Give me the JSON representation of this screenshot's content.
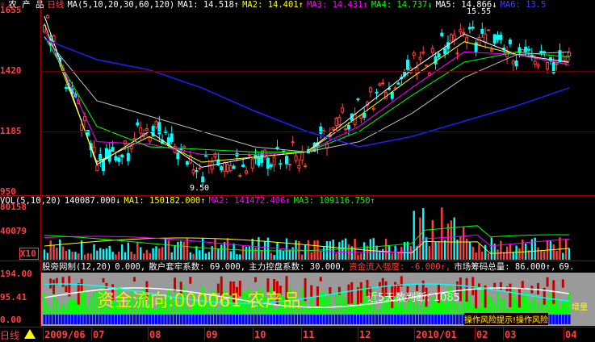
{
  "main": {
    "title_prefix": "农 产 品",
    "period": "日线",
    "ma_params": "MA(5,10,20,30,60,120)",
    "ma1": "MA1: 14.518↑",
    "ma2": "MA2: 14.401↑",
    "ma3": "MA3: 14.431↑",
    "ma4": "MA4: 14.737↓",
    "ma5": "MA5: 14.866↓",
    "ma6": "MA6: 13.5",
    "high_label": "15.55",
    "low_label": "9.50",
    "y_labels": [
      "1655",
      "1420",
      "1185",
      "950"
    ]
  },
  "volume": {
    "params": "VOL(5,10,20)",
    "value": "140087.000↓",
    "ma1": "MA1: 150182.000↑",
    "ma2": "MA2: 141472.406↑",
    "ma3": "MA3: 109116.750↑",
    "y_labels": [
      "80158",
      "40079",
      "X10"
    ]
  },
  "indicator": {
    "name": "股旁网制(12,20)",
    "value": "0.000,",
    "text1": "散户套牢系数: 69.000,",
    "text2": "主力控盘系数: 30.000,",
    "text3": "资金流入强度: -6.000↑,",
    "text4": "市场筹码总量: 86.000↑,",
    "text5": "69.",
    "y_labels": [
      "194.00",
      "95.41",
      "0.00"
    ],
    "watermark": "资金流向:000061 农产品",
    "watermark2": "近5天数判断: 1085",
    "right_note": "增量",
    "bottom_note": "操作风险提示!操作风险"
  },
  "datebar": {
    "period": "日线",
    "dates": [
      "2009/06",
      "07",
      "08",
      "09",
      "10",
      "11",
      "12",
      "2010/01",
      "02",
      "03",
      "04"
    ]
  },
  "chart_data": {
    "type": "line",
    "title": "",
    "x": [
      "2009/06",
      "07",
      "08",
      "09",
      "10",
      "11",
      "12",
      "2010/01",
      "02",
      "03",
      "04"
    ],
    "ylim": [
      9.5,
      16.55
    ],
    "series": [
      {
        "name": "MA1",
        "values": [
          16.3,
          10.5,
          11.8,
          10.4,
          10.8,
          11.0,
          12.6,
          14.2,
          15.6,
          14.8,
          14.5
        ]
      },
      {
        "name": "MA2",
        "values": [
          16.0,
          10.6,
          11.6,
          10.6,
          10.8,
          11.0,
          12.4,
          13.9,
          15.3,
          14.8,
          14.4
        ]
      },
      {
        "name": "MA3",
        "values": [
          15.8,
          11.4,
          11.3,
          10.9,
          10.9,
          11.0,
          12.0,
          13.5,
          14.9,
          14.8,
          14.4
        ]
      },
      {
        "name": "MA4",
        "values": [
          15.5,
          12.0,
          11.2,
          11.1,
          11.0,
          11.0,
          11.8,
          13.2,
          14.5,
          14.9,
          14.7
        ]
      },
      {
        "name": "MA5",
        "values": [
          15.5,
          13.0,
          12.4,
          11.8,
          11.2,
          11.0,
          11.4,
          12.5,
          13.9,
          14.8,
          14.9
        ]
      },
      {
        "name": "MA6",
        "values": [
          15.4,
          14.6,
          14.2,
          13.5,
          12.6,
          11.8,
          11.2,
          11.6,
          12.2,
          12.8,
          13.5
        ]
      }
    ]
  }
}
